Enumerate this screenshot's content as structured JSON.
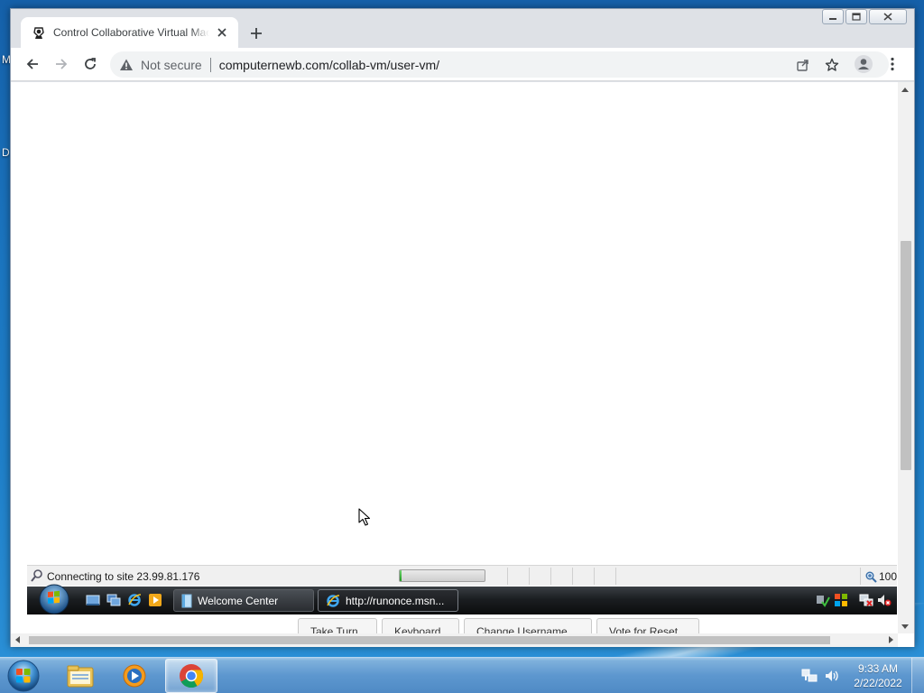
{
  "desktop": {
    "edge_letters": [
      "M",
      "D"
    ]
  },
  "browser": {
    "tab": {
      "title": "Control Collaborative Virtual Machine",
      "favicon": "collabvm-icon",
      "close_icon": "close-icon"
    },
    "new_tab_icon": "plus-icon",
    "window_controls": [
      "minimize-icon",
      "restore-icon",
      "close-icon"
    ],
    "toolbar": {
      "back_icon": "back-arrow-icon",
      "forward_icon": "forward-arrow-icon",
      "reload_icon": "reload-icon",
      "security_label": "Not secure",
      "url": "computernewb.com/collab-vm/user-vm/",
      "share_icon": "share-icon",
      "bookmark_icon": "star-icon",
      "profile_icon": "profile-icon",
      "menu_icon": "kebab-menu-icon"
    }
  },
  "vm": {
    "ie_status": {
      "text": "Connecting to site 23.99.81.176",
      "progress_fraction": 0.02,
      "zoom": "100"
    },
    "vista_taskbar": {
      "tasks": [
        {
          "label": "Welcome Center",
          "icon": "welcome-center-icon",
          "active": false
        },
        {
          "label": "http://runonce.msn...",
          "icon": "ie-icon",
          "active": true
        }
      ]
    },
    "buttons": [
      "Take Turn",
      "Keyboard",
      "Change Username",
      "Vote for Reset"
    ]
  },
  "taskbar": {
    "items": [
      {
        "name": "explorer-icon",
        "active": false
      },
      {
        "name": "media-player-icon",
        "active": false
      },
      {
        "name": "chrome-icon",
        "active": true
      }
    ],
    "clock": {
      "time": "9:33 AM",
      "date": "2/22/2022"
    }
  },
  "colors": {
    "desktop_blue": "#1f7fc8",
    "chrome_frame": "#dee1e6",
    "progress_green": "#1f9a1f"
  }
}
